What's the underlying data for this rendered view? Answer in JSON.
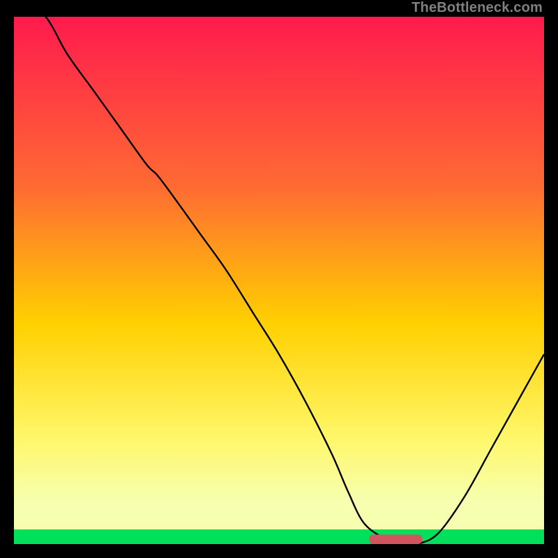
{
  "attribution": "TheBottleneck.com",
  "colors": {
    "gradient_top": "#ff1a4d",
    "gradient_mid1": "#ff6a33",
    "gradient_mid2": "#ffd000",
    "gradient_mid3": "#fff76a",
    "gradient_mid4": "#f6ffb0",
    "gradient_green": "#00e05a",
    "marker": "#d1555e",
    "background": "#000000",
    "curve": "#000000",
    "attribution_text": "#808080"
  },
  "chart_data": {
    "type": "line",
    "title": "",
    "xlabel": "",
    "ylabel": "",
    "xlim": [
      0,
      100
    ],
    "ylim": [
      0,
      100
    ],
    "x": [
      0,
      6,
      10,
      15,
      20,
      25,
      27,
      30,
      35,
      40,
      45,
      50,
      55,
      60,
      63,
      66,
      70,
      73,
      76,
      80,
      85,
      90,
      95,
      100
    ],
    "values": [
      106,
      100,
      93,
      86,
      79,
      72,
      70,
      66,
      59,
      52,
      44,
      36,
      27,
      17,
      10,
      4,
      1,
      0,
      0,
      2,
      9,
      18,
      27,
      36
    ],
    "marker": {
      "x_start": 67,
      "x_end": 77,
      "y": 0.9,
      "height": 1.8
    },
    "annotations": []
  }
}
